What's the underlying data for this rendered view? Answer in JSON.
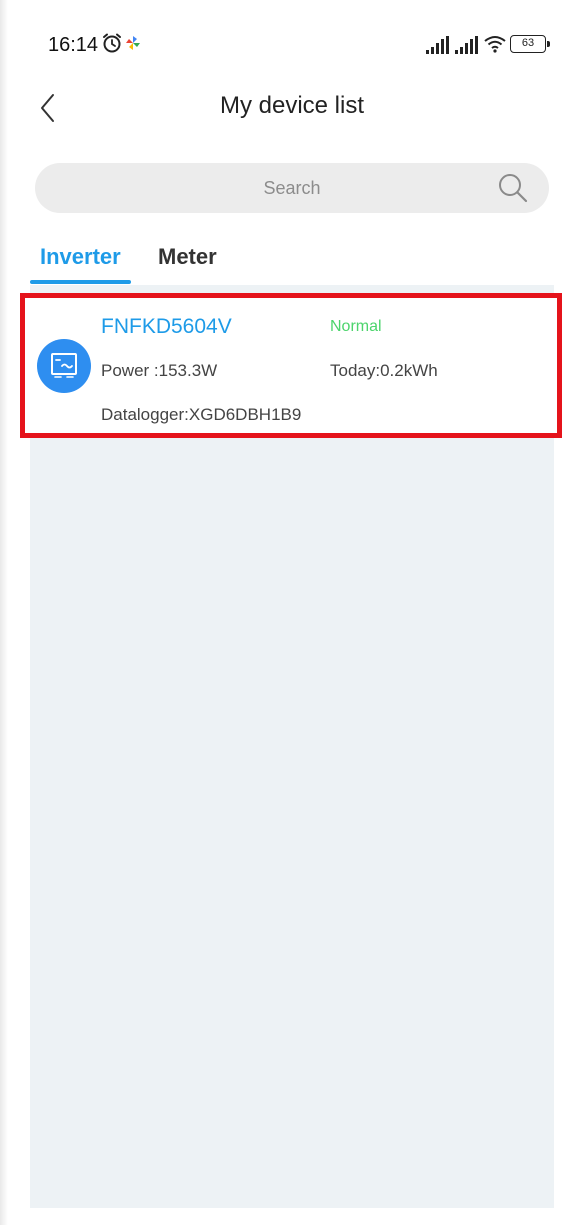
{
  "status_bar": {
    "time": "16:14",
    "battery": "63"
  },
  "header": {
    "title": "My device list"
  },
  "search": {
    "placeholder": "Search",
    "value": ""
  },
  "tabs": [
    {
      "label": "Inverter",
      "active": true
    },
    {
      "label": "Meter",
      "active": false
    }
  ],
  "devices": [
    {
      "serial": "FNFKD5604V",
      "status": "Normal",
      "power": "Power :153.3W",
      "today": "Today:0.2kWh",
      "datalogger": "Datalogger:XGD6DBH1B9",
      "icon": "inverter-icon"
    }
  ],
  "colors": {
    "accent": "#1e9be8",
    "status_normal": "#4cd46c",
    "highlight_border": "#e5131b",
    "list_background": "#edf2f5"
  }
}
